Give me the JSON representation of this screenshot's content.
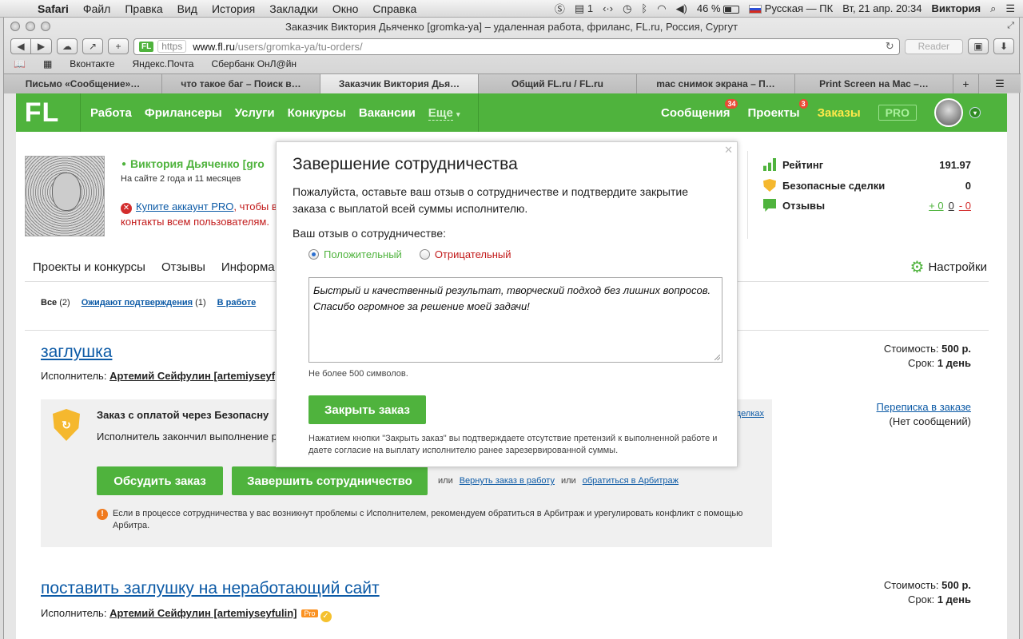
{
  "menubar": {
    "apple": "",
    "app": "Safari",
    "items": [
      "Файл",
      "Правка",
      "Вид",
      "История",
      "Закладки",
      "Окно",
      "Справка"
    ],
    "counter": "1",
    "battery": "46 %",
    "keyboard": "Русская — ПК",
    "clock": "Вт, 21 апр.  20:34",
    "user": "Виктория"
  },
  "window": {
    "title": "Заказчик Виктория Дьяченко [gromka-ya] – удаленная работа, фриланс, FL.ru, Россия, Сургут"
  },
  "toolbar": {
    "favicon": "FL",
    "https": "https",
    "url_host": "www.fl.ru",
    "url_path": "/users/gromka-ya/tu-orders/",
    "reader": "Reader"
  },
  "bookmarks": [
    "Вконтакте",
    "Яндекс.Почта",
    "Сбербанк ОнЛ@йн"
  ],
  "tabs": [
    {
      "label": "Письмо «Сообщение»…",
      "active": false
    },
    {
      "label": "что такое баг – Поиск в…",
      "active": false
    },
    {
      "label": "Заказчик Виктория Дья…",
      "active": true
    },
    {
      "label": "Общий FL.ru / FL.ru",
      "active": false
    },
    {
      "label": "mac снимок экрана – П…",
      "active": false
    },
    {
      "label": "Print Screen на Mac –…",
      "active": false
    }
  ],
  "header": {
    "logo": "FL",
    "nav": [
      "Работа",
      "Фрилансеры",
      "Услуги",
      "Конкурсы",
      "Вакансии"
    ],
    "more": "Еще",
    "messages": "Сообщения",
    "messages_count": "34",
    "projects": "Проекты",
    "projects_count": "3",
    "orders": "Заказы",
    "pro": "PRO"
  },
  "profile": {
    "name": "Виктория Дьяченко [gro",
    "onsite": "На сайте 2 года и 11 месяцев",
    "buy_pro_link": "Купите аккаунт PRO",
    "buy_pro_rest": ", чтобы в",
    "buy_pro_line2": "контакты всем пользователям."
  },
  "stats": {
    "rating_label": "Рейтинг",
    "rating_value": "191.97",
    "safe_label": "Безопасные сделки",
    "safe_value": "0",
    "reviews_label": "Отзывы",
    "reviews_pos": "+ 0",
    "reviews_neu": "0",
    "reviews_neg": "- 0"
  },
  "profile_tabs": [
    "Проекты и конкурсы",
    "Отзывы",
    "Информа"
  ],
  "settings": "Настройки",
  "filters": {
    "all": "Все",
    "all_count": "(2)",
    "waiting": "Ожидают подтверждения",
    "waiting_count": "(1)",
    "in_work": "В работе"
  },
  "orders": [
    {
      "title": "заглушка",
      "executor_label": "Исполнитель:",
      "executor": "Артемий Сейфулин [artemiyseyf",
      "cost_label": "Стоимость:",
      "cost": "500 р.",
      "term_label": "Срок:",
      "term": "1 день"
    },
    {
      "title": "поставить заглушку на неработающий сайт",
      "executor_label": "Исполнитель:",
      "executor": "Артемий Сейфулин [artemiyseyfulin]",
      "pro_badge": "Pro",
      "cost_label": "Стоимость:",
      "cost": "500 р.",
      "term_label": "Срок:",
      "term": "1 день"
    }
  ],
  "safe_box": {
    "title": "Заказ с оплатой через Безопасну",
    "side_link": "делках",
    "text": "Исполнитель закончил выполнение р                                                                                                   той зарезервированной суммы Исполнит",
    "discuss_btn": "Обсудить заказ",
    "finish_btn": "Завершить сотрудничество",
    "or1": "или",
    "return_link": "Вернуть заказ в работу",
    "or2": "или",
    "arbitrage_link": "обратиться в Арбитраж",
    "warning": "Если в процессе сотрудничества у вас возникнут проблемы с Исполнителем, рекомендуем обратиться в Арбитраж и урегулировать конфликт с помощью Арбитра."
  },
  "correspondence": {
    "link": "Переписка в заказе",
    "status": "(Нет сообщений)"
  },
  "modal": {
    "title": "Завершение сотрудничества",
    "description": "Пожалуйста, оставьте ваш отзыв о сотрудничестве и подтвердите закрытие заказа с выплатой всей суммы исполнителю.",
    "review_label": "Ваш отзыв о сотрудничестве:",
    "positive": "Положительный",
    "negative": "Отрицательный",
    "selected": "positive",
    "review_text": "Быстрый и качественный результат, творческий подход без лишних вопросов. Спасибо огромное за решение моей задачи!",
    "limit": "Не более 500 символов.",
    "close_btn": "Закрыть заказ",
    "note": "Нажатием кнопки \"Закрыть заказ\" вы подтверждаете отсутствие претензий к выполненной работе и даете согласие на выплату исполнителю ранее зарезервированной суммы."
  },
  "colors": {
    "brand_green": "#4fb33d",
    "link_blue": "#0c5aa6",
    "orders_yellow": "#ffe94a",
    "error_red": "#c21a1a"
  }
}
